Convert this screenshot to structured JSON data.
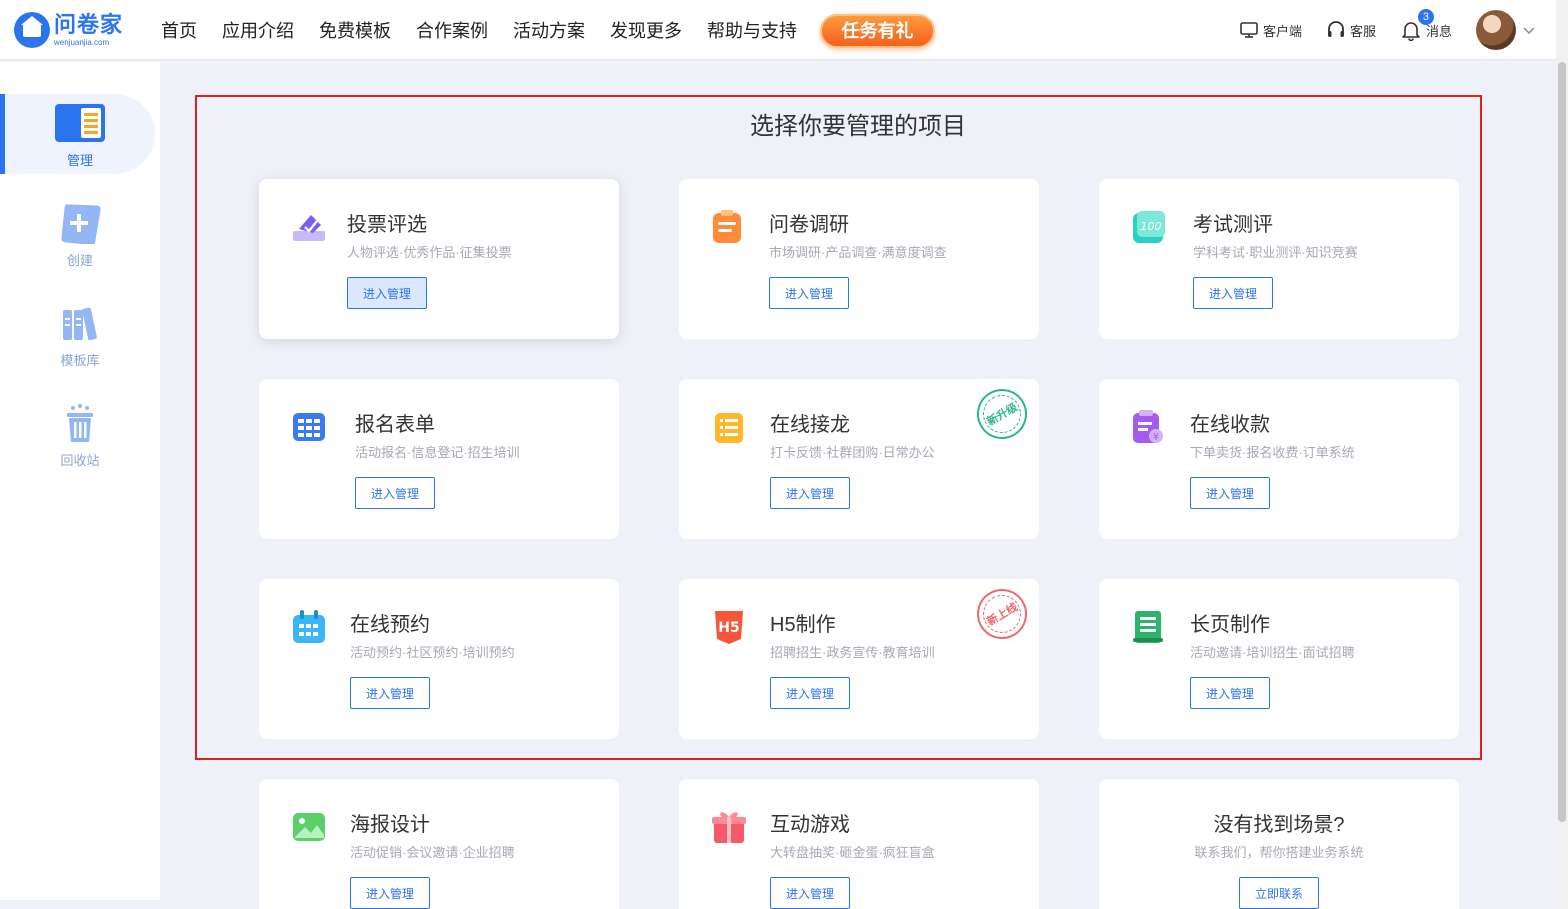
{
  "logo": {
    "cn": "问卷家",
    "en": "wenjuanjia.com"
  },
  "nav": {
    "items": [
      "首页",
      "应用介绍",
      "免费模板",
      "合作案例",
      "活动方案",
      "发现更多",
      "帮助与支持"
    ],
    "badge": "任务有礼"
  },
  "tools": {
    "client": "客户端",
    "service": "客服",
    "messages": "消息",
    "message_count": "3"
  },
  "sidebar": {
    "items": [
      {
        "label": "管理",
        "icon": "manage-icon",
        "active": true
      },
      {
        "label": "创建",
        "icon": "create-icon"
      },
      {
        "label": "模板库",
        "icon": "template-library-icon"
      },
      {
        "label": "回收站",
        "icon": "recycle-bin-icon"
      }
    ]
  },
  "main": {
    "title": "选择你要管理的项目",
    "cards": [
      {
        "title": "投票评选",
        "sub": "人物评选·优秀作品·征集投票",
        "btn": "进入管理",
        "icon": "vote-icon",
        "color": "#7b5cf5"
      },
      {
        "title": "问卷调研",
        "sub": "市场调研·产品调查·满意度调查",
        "btn": "进入管理",
        "icon": "survey-icon",
        "color": "#ff8a3a"
      },
      {
        "title": "考试测评",
        "sub": "学科考试·职业测评·知识竞赛",
        "btn": "进入管理",
        "icon": "exam-icon",
        "color": "#2ad0c0"
      },
      {
        "title": "报名表单",
        "sub": "活动报名·信息登记·招生培训",
        "btn": "进入管理",
        "icon": "form-icon",
        "color": "#3a7bf5"
      },
      {
        "title": "在线接龙",
        "sub": "打卡反馈·社群团购·日常办公",
        "btn": "进入管理",
        "icon": "relay-icon",
        "color": "#ffb62a",
        "stamp": "新升级"
      },
      {
        "title": "在线收款",
        "sub": "下单卖货·报名收费·订单系统",
        "btn": "进入管理",
        "icon": "payment-icon",
        "color": "#a45cf0"
      },
      {
        "title": "在线预约",
        "sub": "活动预约·社区预约·培训预约",
        "btn": "进入管理",
        "icon": "booking-icon",
        "color": "#3ab5f5"
      },
      {
        "title": "H5制作",
        "sub": "招聘招生·政务宣传·教育培训",
        "btn": "进入管理",
        "icon": "h5-icon",
        "color": "#f5563a",
        "stamp": "新上线"
      },
      {
        "title": "长页制作",
        "sub": "活动邀请·培训招生·面试招聘",
        "btn": "进入管理",
        "icon": "long-page-icon",
        "color": "#2ab56a"
      },
      {
        "title": "海报设计",
        "sub": "活动促销·会议邀请·企业招聘",
        "btn": "进入管理",
        "icon": "poster-icon",
        "color": "#5ad06a"
      },
      {
        "title": "互动游戏",
        "sub": "大转盘抽奖·砸金蛋·疯狂盲盒",
        "btn": "进入管理",
        "icon": "game-icon",
        "color": "#f55a6a"
      },
      {
        "title": "没有找到场景?",
        "sub": "联系我们，帮你搭建业务系统",
        "btn": "立即联系",
        "icon": "",
        "color": ""
      }
    ]
  }
}
